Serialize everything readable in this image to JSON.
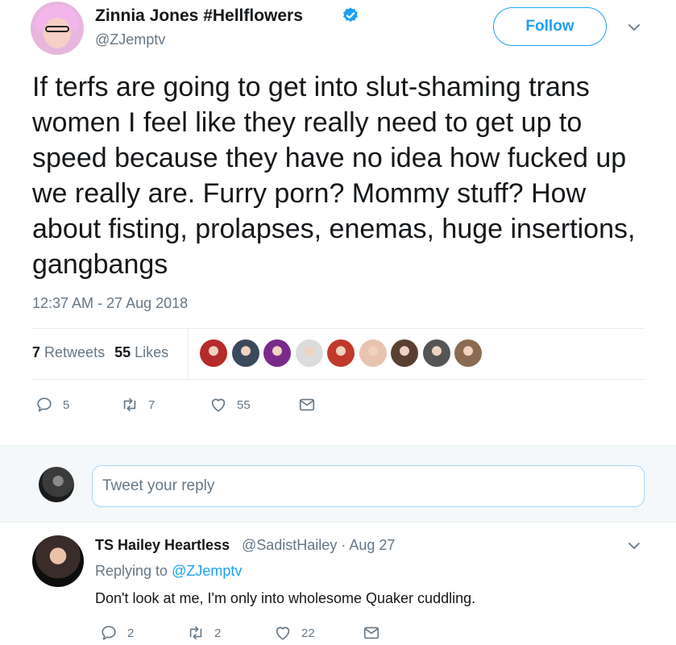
{
  "tweet": {
    "display_name": "Zinnia Jones #Hellflowers",
    "handle": "@ZJemptv",
    "follow_label": "Follow",
    "text": "If terfs are going to get into slut-shaming trans women I feel like they really need to get up to speed because they have no idea how fucked up we really are. Furry porn? Mommy stuff? How about fisting, prolapses, enemas, huge insertions, gangbangs",
    "timestamp": "12:37 AM - 27 Aug 2018",
    "retweets_count": "7",
    "retweets_label": "Retweets",
    "likes_count": "55",
    "likes_label": "Likes",
    "actions": {
      "reply_count": "5",
      "retweet_count": "7",
      "like_count": "55"
    },
    "likers": [
      {
        "name": "liker-1",
        "color": "#b52a2a"
      },
      {
        "name": "liker-2",
        "color": "#3a4a5c"
      },
      {
        "name": "liker-3",
        "color": "#7a2a8a"
      },
      {
        "name": "liker-4",
        "color": "#dcdcdc"
      },
      {
        "name": "liker-5",
        "color": "#c0392b"
      },
      {
        "name": "liker-6",
        "color": "#e8c4b0"
      },
      {
        "name": "liker-7",
        "color": "#5a4030"
      },
      {
        "name": "liker-8",
        "color": "#555555"
      },
      {
        "name": "liker-9",
        "color": "#8a6a50"
      }
    ]
  },
  "reply_box": {
    "placeholder": "Tweet your reply"
  },
  "reply": {
    "display_name": "TS Hailey Heartless",
    "handle_and_date": "@SadistHailey · Aug 27",
    "replying_prefix": "Replying to",
    "replying_to": "@ZJemptv",
    "text": "Don't look at me, I'm only into wholesome Quaker cuddling.",
    "actions": {
      "reply_count": "2",
      "retweet_count": "2",
      "like_count": "22"
    }
  },
  "colors": {
    "accent": "#1da1f2",
    "muted": "#657786",
    "text": "#14171a",
    "divider": "#e6ecf0"
  }
}
